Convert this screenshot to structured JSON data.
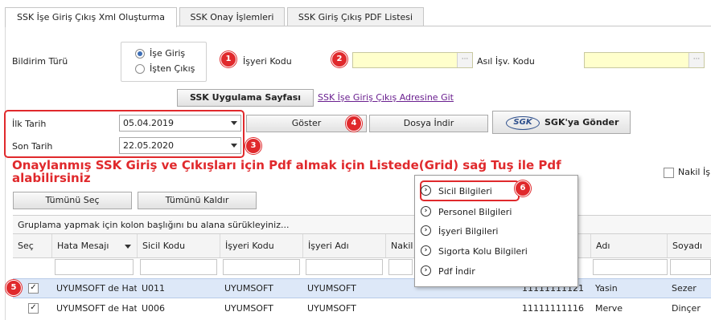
{
  "tabs": [
    {
      "label": "SSK İşe Giriş Çıkış Xml Oluşturma",
      "active": true
    },
    {
      "label": "SSK Onay İşlemleri",
      "active": false
    },
    {
      "label": "SSK Giriş Çıkış PDF Listesi",
      "active": false
    }
  ],
  "form": {
    "bildirim_turu_label": "Bildirim Türü",
    "radio_ise_giris": "İşe Giriş",
    "radio_isten_cikis": "İşten Çıkış",
    "isyeri_kodu_label": "İşyeri Kodu",
    "asil_isv_kodu_label": "Asıl İşv. Kodu",
    "isyeri_kodu_value": "",
    "asil_isv_kodu_value": "",
    "ellipsis": "···",
    "ssk_page_button": "SSK Uygulama Sayfası",
    "ssk_link": "SSK İşe Giriş Çıkış Adresine Git",
    "ilk_tarih_label": "İlk Tarih",
    "ilk_tarih_value": "05.04.2019",
    "son_tarih_label": "Son Tarih",
    "son_tarih_value": "22.05.2020",
    "goster_button": "Göster",
    "dosya_indir_button": "Dosya İndir",
    "sgk_logo": "SGK",
    "sgk_gonder_button": "SGK'ya Gönder",
    "nakil_label": "Nakil İş"
  },
  "badges": [
    "1",
    "2",
    "3",
    "4",
    "5",
    "6"
  ],
  "instruction": "Onaylanmış SSK Giriş ve Çıkışları için Pdf almak için Listede(Grid) sağ Tuş ile Pdf alabilirsiniz",
  "buttons": {
    "select_all": "Tümünü Seç",
    "deselect_all": "Tümünü Kaldır"
  },
  "grid": {
    "group_hint": "Gruplama yapmak için kolon başlığını bu alana sürükleyiniz...",
    "columns": [
      "Seç",
      "Hata Mesajı",
      "Sicil Kodu",
      "İşyeri Kodu",
      "İşyeri Adı",
      "Nakil",
      "Adı",
      "Soyadı"
    ],
    "rows": [
      {
        "selected": true,
        "hata": "UYUMSOFT de Hat",
        "sicil": "U011",
        "isyeri_kodu": "UYUMSOFT",
        "isyeri_adi": "UYUMSOFT",
        "tc": "11111111121",
        "adi": "Yasin",
        "soyadi": "Sezer"
      },
      {
        "selected": true,
        "hata": "UYUMSOFT de Hat",
        "sicil": "U006",
        "isyeri_kodu": "UYUMSOFT",
        "isyeri_adi": "UYUMSOFT",
        "tc": "11111111116",
        "adi": "Merve",
        "soyadi": "Dinçer"
      }
    ]
  },
  "context_menu": [
    {
      "label": "Sicil Bilgileri",
      "icon": "chevron-circle-icon"
    },
    {
      "label": "Personel Bilgileri",
      "icon": "chevron-circle-icon"
    },
    {
      "label": "İşyeri Bilgileri",
      "icon": "chevron-circle-icon"
    },
    {
      "label": "Sigorta Kolu Bilgileri",
      "icon": "chevron-circle-icon"
    },
    {
      "label": "Pdf İndir",
      "icon": "chevron-circle-icon"
    }
  ],
  "colors": {
    "accent_red": "#e0292c",
    "input_yellow": "#ffffcc",
    "selected_row": "#dde8f8"
  }
}
